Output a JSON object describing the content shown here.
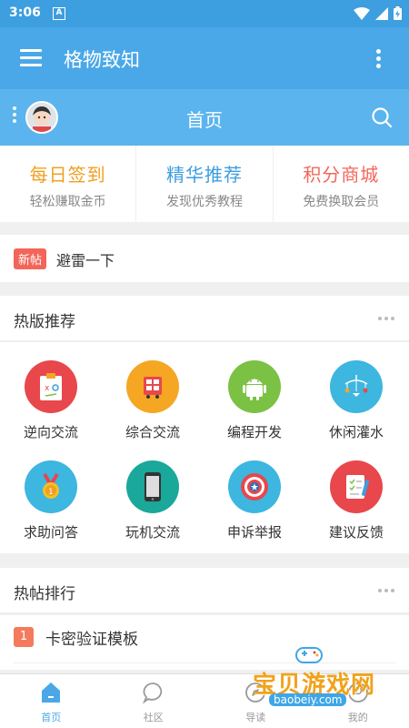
{
  "status": {
    "time": "3:06",
    "a_label": "A"
  },
  "appbar": {
    "title": "格物致知"
  },
  "subbar": {
    "title": "首页"
  },
  "quick": [
    {
      "title": "每日签到",
      "sub": "轻松赚取金币",
      "color": "#f0a020"
    },
    {
      "title": "精华推荐",
      "sub": "发现优秀教程",
      "color": "#3d9ee0"
    },
    {
      "title": "积分商城",
      "sub": "免费换取会员",
      "color": "#f2665a"
    }
  ],
  "notice": {
    "badge": "新帖",
    "text": "避雷一下"
  },
  "hot_sections": {
    "title": "热版推荐"
  },
  "grid": [
    {
      "label": "逆向交流",
      "icon": "clipboard-icon",
      "color": "#e8474c"
    },
    {
      "label": "综合交流",
      "icon": "bus-icon",
      "color": "#f5a623"
    },
    {
      "label": "编程开发",
      "icon": "android-icon",
      "color": "#7bc144"
    },
    {
      "label": "休闲灌水",
      "icon": "mobile-toy-icon",
      "color": "#3db6e0"
    },
    {
      "label": "求助问答",
      "icon": "medal-icon",
      "color": "#3db6e0"
    },
    {
      "label": "玩机交流",
      "icon": "phone-icon",
      "color": "#1aa89a"
    },
    {
      "label": "申诉举报",
      "icon": "shield-icon",
      "color": "#3db6e0"
    },
    {
      "label": "建议反馈",
      "icon": "notebook-icon",
      "color": "#e8474c"
    }
  ],
  "hot_posts": {
    "title": "热帖排行",
    "items": [
      {
        "rank": "1",
        "title": "卡密验证模板"
      }
    ]
  },
  "tabs": [
    {
      "label": "首页",
      "icon": "home-icon",
      "active": true
    },
    {
      "label": "社区",
      "icon": "chat-icon",
      "active": false
    },
    {
      "label": "导读",
      "icon": "compass-icon",
      "active": false
    },
    {
      "label": "我的",
      "icon": "user-icon",
      "active": false
    }
  ],
  "watermark": {
    "text": "宝贝游戏网",
    "url": "baobeiy.com"
  }
}
